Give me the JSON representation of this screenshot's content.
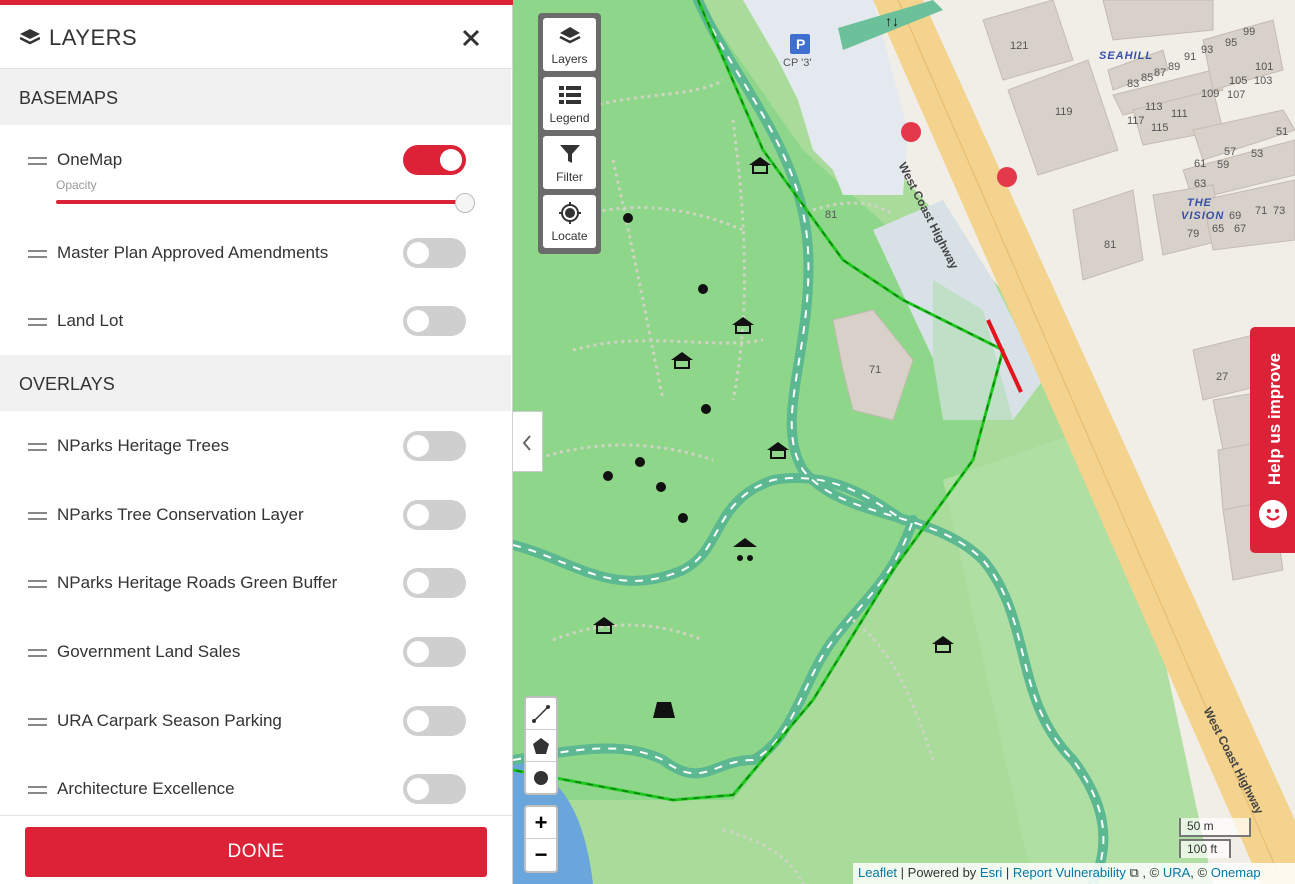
{
  "panel": {
    "title": "LAYERS",
    "basemaps_heading": "BASEMAPS",
    "overlays_heading": "OVERLAYS",
    "opacity_label": "Opacity",
    "opacity_value": 1.0,
    "basemaps": [
      {
        "label": "OneMap",
        "enabled": true
      },
      {
        "label": "Master Plan Approved Amendments",
        "enabled": false
      },
      {
        "label": "Land Lot",
        "enabled": false
      }
    ],
    "overlays": [
      {
        "label": "NParks Heritage Trees",
        "enabled": false
      },
      {
        "label": "NParks Tree Conservation Layer",
        "enabled": false
      },
      {
        "label": "NParks Heritage Roads Green Buffer",
        "enabled": false
      },
      {
        "label": "Government Land Sales",
        "enabled": false
      },
      {
        "label": "URA Carpark Season Parking",
        "enabled": false
      },
      {
        "label": "Architecture Excellence",
        "enabled": false
      }
    ],
    "done_label": "DONE"
  },
  "map_tools": {
    "layers": "Layers",
    "legend": "Legend",
    "filter": "Filter",
    "locate": "Locate"
  },
  "zoom": {
    "in": "+",
    "out": "−"
  },
  "scale": {
    "metric": "50 m",
    "imperial": "100 ft"
  },
  "attribution": {
    "leaflet": "Leaflet",
    "sep1": " | Powered by ",
    "esri": "Esri",
    "sep2": " | ",
    "report": "Report Vulnerability",
    "sep3": " , © ",
    "ura": "URA",
    "sep4": ", © ",
    "onemap": "Onemap"
  },
  "help": {
    "label": "Help us improve"
  },
  "map_labels": {
    "carpark": "CP '3'",
    "road1": "West Coast Highway",
    "road2": "West Coast Highway",
    "seahill": "SEAHILL",
    "the": "THE",
    "vision": "VISION",
    "b121": "121",
    "b119": "119",
    "b81a": "81",
    "b81b": "81",
    "b71": "71",
    "b27": "27",
    "b99": "99",
    "b95": "95",
    "b93": "93",
    "b91": "91",
    "b89": "89",
    "b87": "87",
    "b85": "85",
    "b83": "83",
    "b105": "105",
    "b103": "103",
    "b101": "101",
    "b109": "109",
    "b107": "107",
    "b113": "113",
    "b111": "111",
    "b117": "117",
    "b115": "115",
    "b51": "51",
    "b57": "57",
    "b53": "53",
    "b61": "61",
    "b59": "59",
    "b63": "63",
    "b69": "69",
    "b71b": "71",
    "b73": "73",
    "b65": "65",
    "b67": "67",
    "b79": "79"
  },
  "colors": {
    "accent": "#dc2237",
    "park": "#8fd98a",
    "path": "#5cb88a",
    "road": "#f5d38a",
    "boundary": "#1ec71e"
  }
}
